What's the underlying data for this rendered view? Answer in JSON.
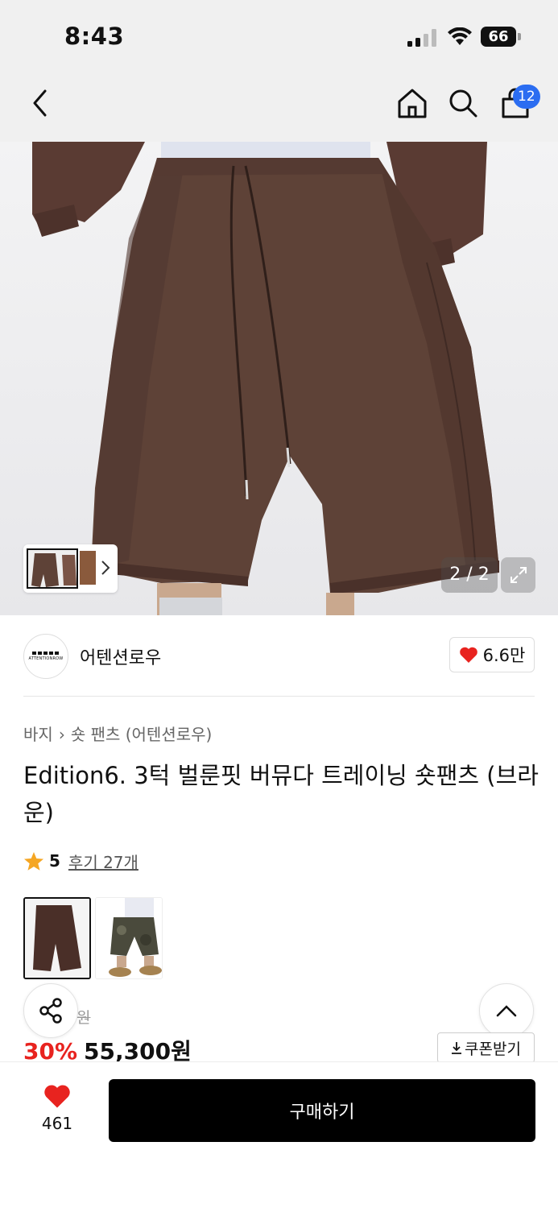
{
  "status_bar": {
    "time": "8:43",
    "battery": "66"
  },
  "nav": {
    "cart_count": "12"
  },
  "gallery": {
    "counter": "2 / 2"
  },
  "brand": {
    "name": "어텐션로우",
    "logo_text": "ATTENTIONROW",
    "likes": "6.6만"
  },
  "breadcrumb": [
    "바지",
    "숏 팬츠 (어텐션로우)"
  ],
  "product": {
    "title": "Edition6. 3턱 벌룬핏 버뮤다 트레이닝 숏팬츠 (브라운)",
    "rating": "5",
    "reviews": "후기 27개",
    "original_price_suffix": "원",
    "discount": "30%",
    "price": "55,300원"
  },
  "actions": {
    "coupon": "쿠폰받기",
    "buy": "구매하기",
    "favorite_count": "461"
  },
  "colors": {
    "accent_blue": "#2b6df1",
    "discount_red": "#e8231f",
    "heart_red": "#e8231f",
    "star": "#f5a623",
    "product_brown": "#5e4237"
  },
  "icons": [
    "back-icon",
    "home-icon",
    "search-icon",
    "cart-icon",
    "chevron-right-icon",
    "expand-icon",
    "heart-icon",
    "star-icon",
    "share-icon",
    "chevron-up-icon",
    "download-icon"
  ]
}
